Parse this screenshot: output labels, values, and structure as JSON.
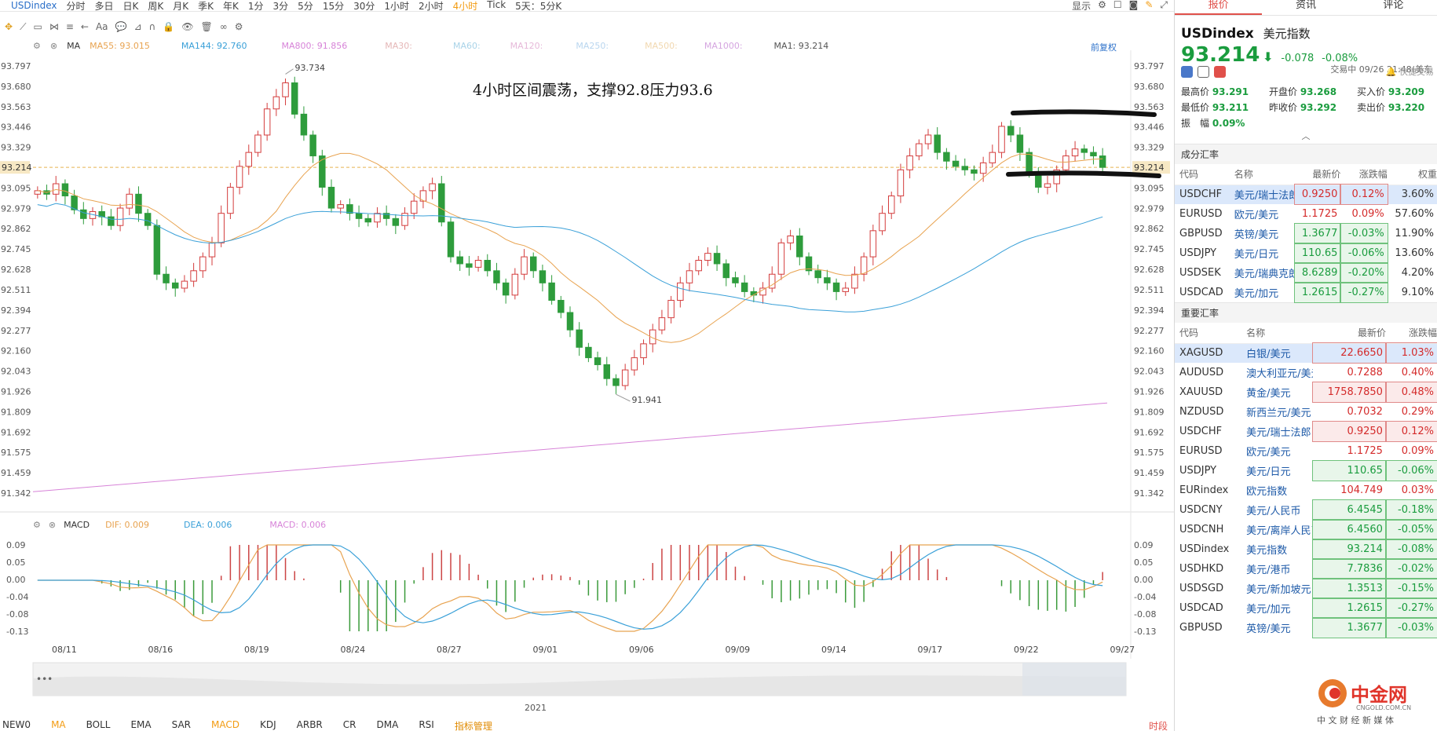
{
  "toolbar": {
    "symbol": "USDindex",
    "timeframes": [
      "分时",
      "多日",
      "日K",
      "周K",
      "月K",
      "季K",
      "年K",
      "1分",
      "3分",
      "5分",
      "15分",
      "30分",
      "1小时",
      "2小时",
      "4小时",
      "Tick",
      "5天：5分K"
    ],
    "active_timeframe": "4小时",
    "display_label": "显示",
    "back_adjust": "前复权"
  },
  "legend_main": {
    "ma_label": "MA",
    "ma55": "MA55: 93.015",
    "ma144": "MA144: 92.760",
    "ma800": "MA800: 91.856",
    "ma30": "MA30:",
    "ma60": "MA60:",
    "ma120": "MA120:",
    "ma250": "MA250:",
    "ma500": "MA500:",
    "ma1000": "MA1000:",
    "ma1": "MA1: 93.214"
  },
  "legend_macd": {
    "label": "MACD",
    "dif": "DIF: 0.009",
    "dea": "DEA: 0.006",
    "macd": "MACD: 0.006"
  },
  "annotation": "4小时区间震荡，支撑92.8压力93.6",
  "year_label": "2021",
  "chart_data": {
    "type": "candlestick",
    "y_ticks": [
      "93.797",
      "93.680",
      "93.563",
      "93.446",
      "93.329",
      "93.214",
      "93.095",
      "92.979",
      "92.862",
      "92.745",
      "92.628",
      "92.511",
      "92.394",
      "92.277",
      "92.160",
      "92.043",
      "91.926",
      "91.809",
      "91.692",
      "91.575",
      "91.459",
      "91.342"
    ],
    "ylim": [
      91.342,
      93.797
    ],
    "current_price": "93.214",
    "high_label": "93.734",
    "low_label": "91.941",
    "x_labels": [
      "08/11",
      "08/16",
      "08/19",
      "08/24",
      "08/27",
      "09/01",
      "09/06",
      "09/09",
      "09/14",
      "09/17",
      "09/22",
      "09/27"
    ],
    "closes": [
      93.08,
      93.06,
      93.12,
      93.05,
      92.97,
      92.92,
      92.96,
      92.93,
      92.88,
      92.98,
      93.06,
      92.95,
      92.88,
      92.6,
      92.55,
      92.52,
      92.56,
      92.62,
      92.7,
      92.78,
      92.95,
      93.1,
      93.22,
      93.3,
      93.4,
      93.55,
      93.62,
      93.7,
      93.52,
      93.4,
      93.28,
      93.1,
      92.98,
      93.0,
      92.95,
      92.92,
      92.9,
      92.95,
      92.92,
      92.88,
      92.95,
      93.02,
      93.08,
      93.12,
      92.9,
      92.7,
      92.66,
      92.64,
      92.68,
      92.62,
      92.55,
      92.48,
      92.6,
      92.7,
      92.62,
      92.55,
      92.45,
      92.38,
      92.28,
      92.18,
      92.12,
      92.08,
      92.0,
      91.96,
      92.05,
      92.12,
      92.2,
      92.28,
      92.35,
      92.45,
      92.55,
      92.62,
      92.68,
      92.72,
      92.66,
      92.58,
      92.55,
      92.5,
      92.48,
      92.52,
      92.6,
      92.78,
      92.82,
      92.7,
      92.62,
      92.58,
      92.55,
      92.5,
      92.52,
      92.6,
      92.7,
      92.85,
      92.95,
      93.05,
      93.2,
      93.28,
      93.35,
      93.4,
      93.3,
      93.25,
      93.22,
      93.2,
      93.18,
      93.24,
      93.3,
      93.45,
      93.4,
      93.3,
      93.18,
      93.1,
      93.12,
      93.2,
      93.28,
      93.32,
      93.3,
      93.28,
      93.214
    ],
    "series": [
      {
        "name": "MA55",
        "color": "#e8a350"
      },
      {
        "name": "MA144",
        "color": "#3aa0d8"
      },
      {
        "name": "MA800",
        "color": "#d783d8"
      }
    ],
    "macd_ticks": [
      "0.09",
      "0.05",
      "0.00",
      "-0.04",
      "-0.08",
      "-0.13"
    ],
    "macd_ylim": [
      -0.13,
      0.09
    ]
  },
  "bottom_tabs": [
    "NEW0",
    "MA",
    "BOLL",
    "EMA",
    "SAR",
    "MACD",
    "KDJ",
    "ARBR",
    "CR",
    "DMA",
    "RSI",
    "指标管理",
    "时段"
  ],
  "bottom_active": [
    "MA",
    "MACD"
  ],
  "panel": {
    "tabs": [
      "报价",
      "资讯",
      "评论"
    ],
    "code": "USDindex",
    "name": "美元指数",
    "price": "93.214",
    "change": "-0.078",
    "change_pct": "-0.08%",
    "time": "交易中 09/26 21:48(美东",
    "quick_label": "快捷交易",
    "stats": [
      {
        "k": "最高价",
        "v": "93.291"
      },
      {
        "k": "开盘价",
        "v": "93.268"
      },
      {
        "k": "买入价",
        "v": "93.209"
      },
      {
        "k": "最低价",
        "v": "93.211"
      },
      {
        "k": "昨收价",
        "v": "93.292"
      },
      {
        "k": "卖出价",
        "v": "93.220"
      },
      {
        "k": "振　幅",
        "v": "0.09%"
      }
    ],
    "components_title": "成分汇率",
    "components_headers": [
      "代码",
      "名称",
      "最新价",
      "涨跌幅",
      "权重"
    ],
    "components": [
      {
        "code": "USDCHF",
        "name": "美元/瑞士法郎",
        "price": "0.9250",
        "chg": "0.12%",
        "weight": "3.60%",
        "dir": "up"
      },
      {
        "code": "EURUSD",
        "name": "欧元/美元",
        "price": "1.1725",
        "chg": "0.09%",
        "weight": "57.60%",
        "dir": "up"
      },
      {
        "code": "GBPUSD",
        "name": "英镑/美元",
        "price": "1.3677",
        "chg": "-0.03%",
        "weight": "11.90%",
        "dir": "dn"
      },
      {
        "code": "USDJPY",
        "name": "美元/日元",
        "price": "110.65",
        "chg": "-0.06%",
        "weight": "13.60%",
        "dir": "dn"
      },
      {
        "code": "USDSEK",
        "name": "美元/瑞典克朗",
        "price": "8.6289",
        "chg": "-0.20%",
        "weight": "4.20%",
        "dir": "dn"
      },
      {
        "code": "USDCAD",
        "name": "美元/加元",
        "price": "1.2615",
        "chg": "-0.27%",
        "weight": "9.10%",
        "dir": "dn"
      }
    ],
    "major_title": "重要汇率",
    "major_headers": [
      "代码",
      "名称",
      "最新价",
      "涨跌幅"
    ],
    "major": [
      {
        "code": "XAGUSD",
        "name": "白银/美元",
        "price": "22.6650",
        "chg": "1.03%",
        "dir": "up"
      },
      {
        "code": "AUDUSD",
        "name": "澳大利亚元/美元",
        "price": "0.7288",
        "chg": "0.40%",
        "dir": "up"
      },
      {
        "code": "XAUUSD",
        "name": "黄金/美元",
        "price": "1758.7850",
        "chg": "0.48%",
        "dir": "up"
      },
      {
        "code": "NZDUSD",
        "name": "新西兰元/美元",
        "price": "0.7032",
        "chg": "0.29%",
        "dir": "up"
      },
      {
        "code": "USDCHF",
        "name": "美元/瑞士法郎",
        "price": "0.9250",
        "chg": "0.12%",
        "dir": "up"
      },
      {
        "code": "EURUSD",
        "name": "欧元/美元",
        "price": "1.1725",
        "chg": "0.09%",
        "dir": "up"
      },
      {
        "code": "USDJPY",
        "name": "美元/日元",
        "price": "110.65",
        "chg": "-0.06%",
        "dir": "dn"
      },
      {
        "code": "EURindex",
        "name": "欧元指数",
        "price": "104.749",
        "chg": "0.03%",
        "dir": "up"
      },
      {
        "code": "USDCNY",
        "name": "美元/人民币",
        "price": "6.4545",
        "chg": "-0.18%",
        "dir": "dn"
      },
      {
        "code": "USDCNH",
        "name": "美元/离岸人民币",
        "price": "6.4560",
        "chg": "-0.05%",
        "dir": "dn"
      },
      {
        "code": "USDindex",
        "name": "美元指数",
        "price": "93.214",
        "chg": "-0.08%",
        "dir": "dn"
      },
      {
        "code": "USDHKD",
        "name": "美元/港币",
        "price": "7.7836",
        "chg": "-0.02%",
        "dir": "dn"
      },
      {
        "code": "USDSGD",
        "name": "美元/新加坡元",
        "price": "1.3513",
        "chg": "-0.15%",
        "dir": "dn"
      },
      {
        "code": "USDCAD",
        "name": "美元/加元",
        "price": "1.2615",
        "chg": "-0.27%",
        "dir": "dn"
      },
      {
        "code": "GBPUSD",
        "name": "英镑/美元",
        "price": "1.3677",
        "chg": "-0.03%",
        "dir": "dn"
      }
    ]
  },
  "brand": {
    "name": "中金网",
    "domain": "CNGOLD.COM.CN",
    "tagline": "中 文 财 经 新 媒 体"
  }
}
